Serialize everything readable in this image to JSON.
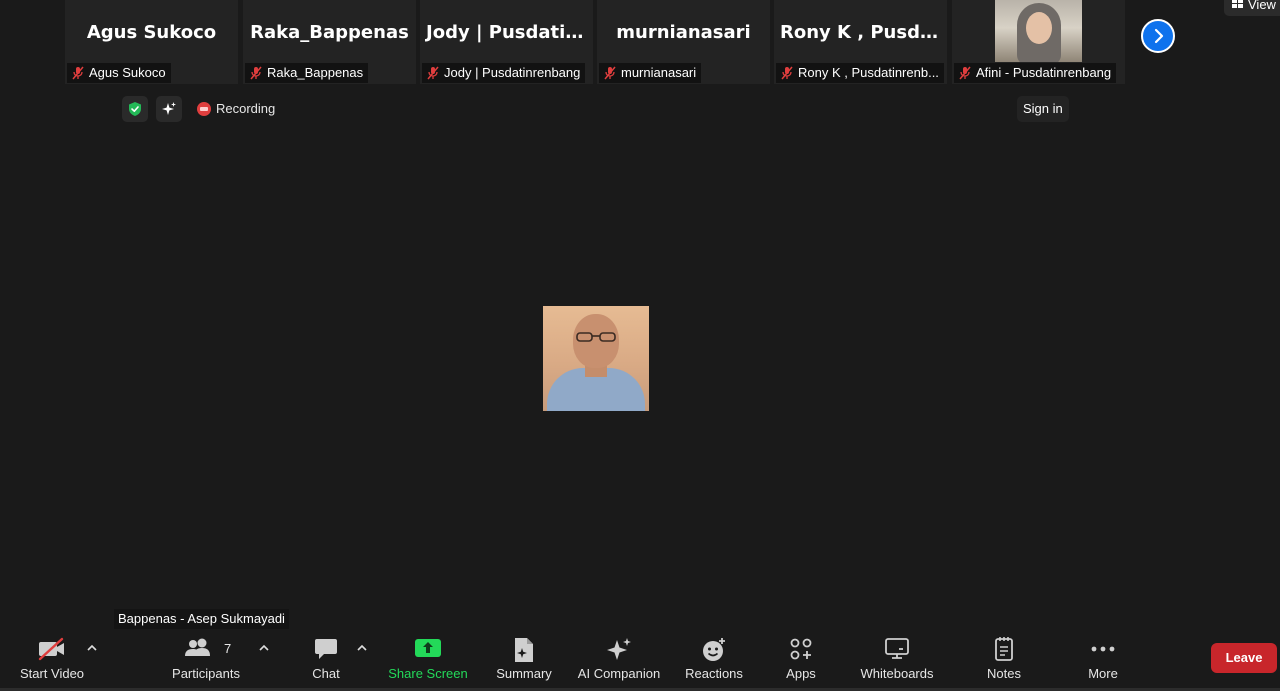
{
  "participants": [
    {
      "display_name": "Agus Sukoco",
      "tag": "Agus Sukoco",
      "has_video": false
    },
    {
      "display_name": "Raka_Bappenas",
      "tag": "Raka_Bappenas",
      "has_video": false
    },
    {
      "display_name": "Jody | Pusdatin...",
      "tag": "Jody | Pusdatinrenbang",
      "has_video": false
    },
    {
      "display_name": "murnianasari",
      "tag": "murnianasari",
      "has_video": false
    },
    {
      "display_name": "Rony K , Pusdat...",
      "tag": "Rony K , Pusdatinrenb...",
      "has_video": false
    },
    {
      "display_name": "",
      "tag": "Afini - Pusdatinrenbang",
      "has_video": true
    }
  ],
  "header": {
    "view_label": "View",
    "sign_in_label": "Sign in",
    "recording_label": "Recording"
  },
  "active_speaker": {
    "name": "Bappenas - Asep Sukmayadi"
  },
  "toolbar": {
    "start_video": "Start Video",
    "participants": "Participants",
    "participants_count": "7",
    "chat": "Chat",
    "share_screen": "Share Screen",
    "summary": "Summary",
    "ai_companion": "AI Companion",
    "reactions": "Reactions",
    "apps": "Apps",
    "whiteboards": "Whiteboards",
    "notes": "Notes",
    "more": "More",
    "leave": "Leave"
  },
  "colors": {
    "background": "#1a1a1a",
    "tile": "#232323",
    "accent_blue": "#0e72ed",
    "share_green": "#23d959",
    "mute_red": "#e03e3e",
    "leave_red": "#c8262b",
    "shield_green": "#23b957"
  },
  "icons": {
    "muted": "mic-muted-icon",
    "next": "chevron-right-icon",
    "security": "shield-check-icon",
    "ai": "sparkle-icon",
    "recording": "record-icon",
    "video_off": "video-off-icon"
  }
}
